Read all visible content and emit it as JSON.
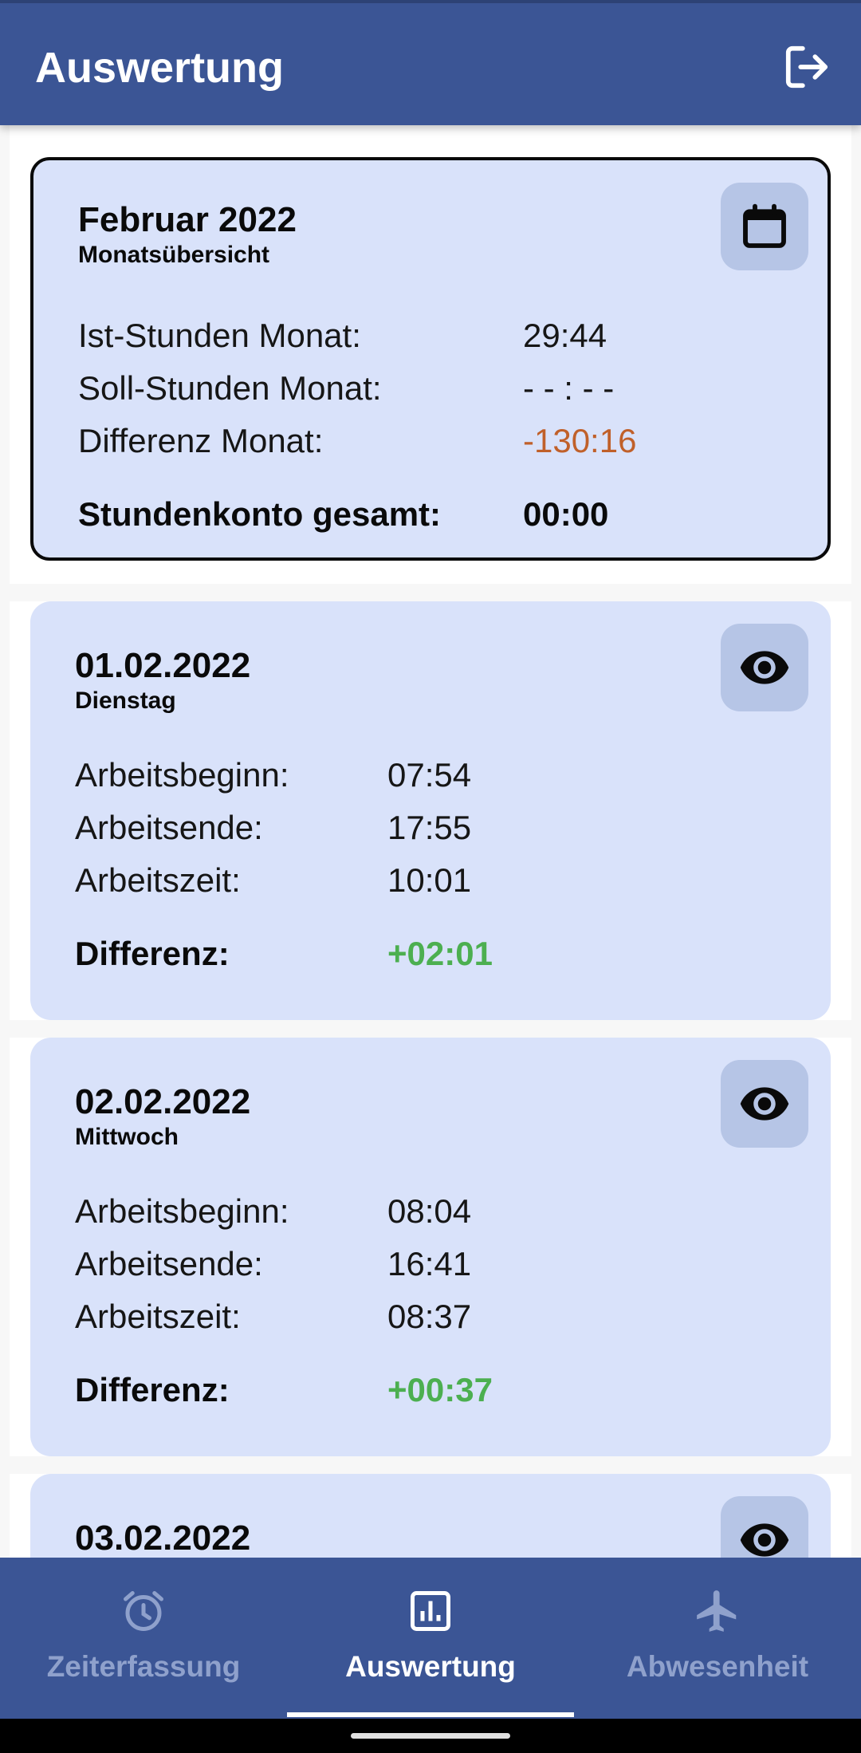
{
  "appbar": {
    "title": "Auswertung"
  },
  "month": {
    "title": "Februar 2022",
    "subtitle": "Monatsübersicht",
    "rows": [
      {
        "label": "Ist-Stunden Monat:",
        "value": "29:44"
      },
      {
        "label": "Soll-Stunden Monat:",
        "value": "- - : - -"
      },
      {
        "label": "Differenz Monat:",
        "value": "-130:16"
      }
    ],
    "total": {
      "label": "Stundenkonto gesamt:",
      "value": "00:00"
    }
  },
  "days": [
    {
      "date": "01.02.2022",
      "weekday": "Dienstag",
      "rows": [
        {
          "label": "Arbeitsbeginn:",
          "value": "07:54"
        },
        {
          "label": "Arbeitsende:",
          "value": "17:55"
        },
        {
          "label": "Arbeitszeit:",
          "value": "10:01"
        }
      ],
      "diff": {
        "label": "Differenz:",
        "value": "+02:01"
      }
    },
    {
      "date": "02.02.2022",
      "weekday": "Mittwoch",
      "rows": [
        {
          "label": "Arbeitsbeginn:",
          "value": "08:04"
        },
        {
          "label": "Arbeitsende:",
          "value": "16:41"
        },
        {
          "label": "Arbeitszeit:",
          "value": "08:37"
        }
      ],
      "diff": {
        "label": "Differenz:",
        "value": "+00:37"
      }
    },
    {
      "date": "03.02.2022"
    }
  ],
  "nav": [
    {
      "label": "Zeiterfassung",
      "icon": "alarm-clock-icon"
    },
    {
      "label": "Auswertung",
      "icon": "bar-chart-icon",
      "active": true
    },
    {
      "label": "Abwesenheit",
      "icon": "airplane-icon"
    }
  ],
  "colors": {
    "primary": "#3b5595",
    "card": "#d9e2fa",
    "negative": "#c0602a",
    "positive": "#4caf50"
  }
}
